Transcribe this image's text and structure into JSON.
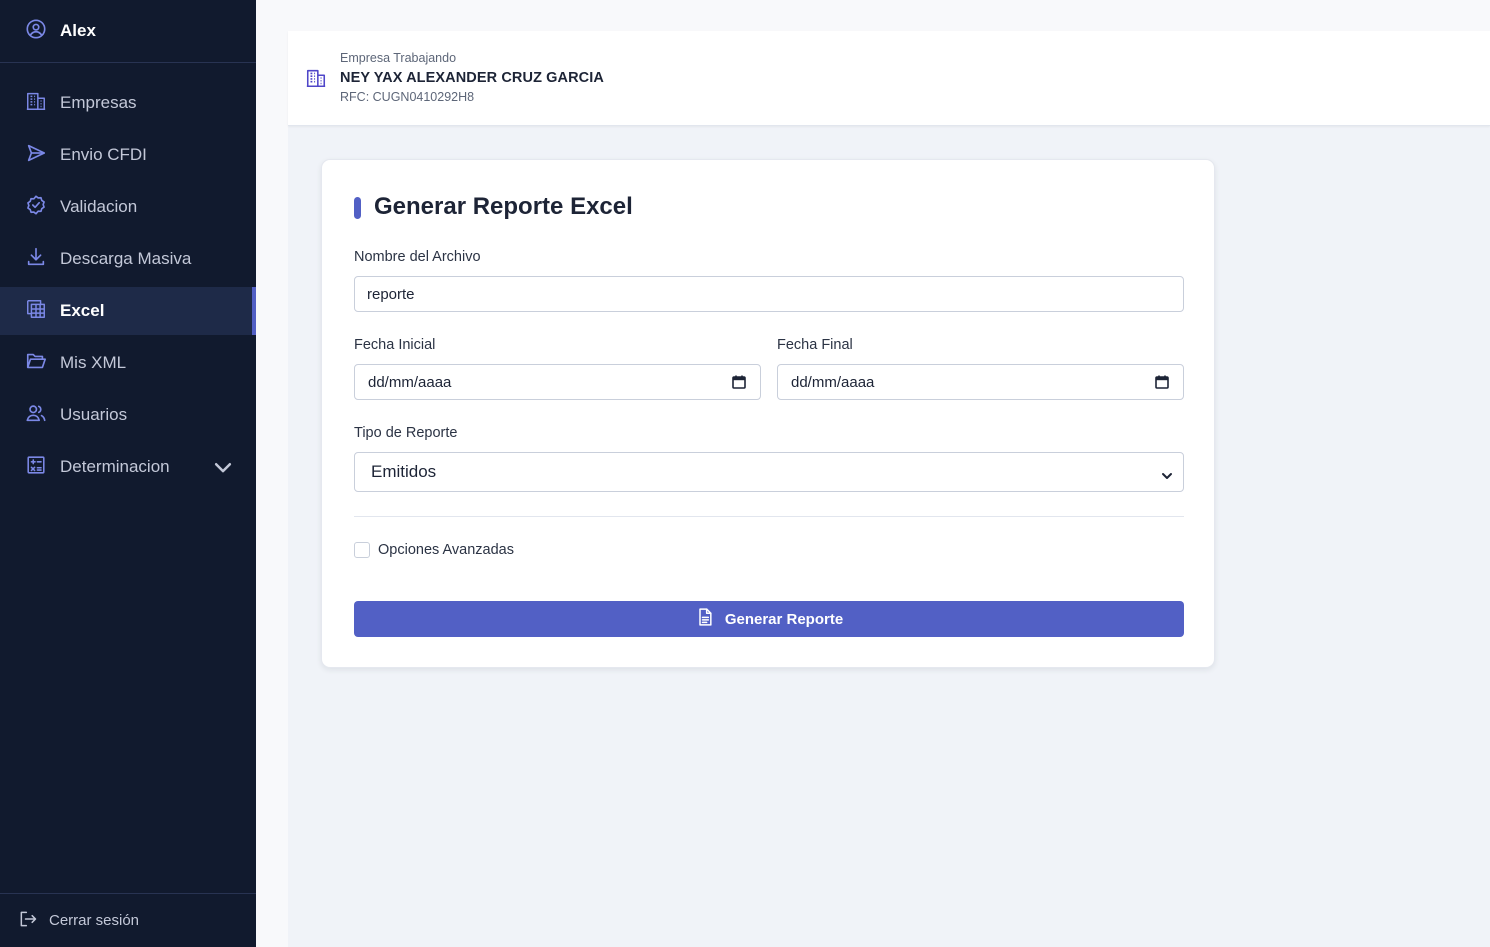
{
  "sidebar": {
    "user": {
      "name": "Alex",
      "icon": "user-circle-icon"
    },
    "items": [
      {
        "label": "Empresas",
        "icon": "building-icon"
      },
      {
        "label": "Envio CFDI",
        "icon": "send-icon"
      },
      {
        "label": "Validacion",
        "icon": "badge-check-icon"
      },
      {
        "label": "Descarga Masiva",
        "icon": "download-icon"
      },
      {
        "label": "Excel",
        "icon": "table-icon",
        "active": true
      },
      {
        "label": "Mis XML",
        "icon": "folder-open-icon"
      },
      {
        "label": "Usuarios",
        "icon": "users-icon"
      },
      {
        "label": "Determinacion",
        "icon": "calculator-icon",
        "expandable": true
      }
    ],
    "logout_label": "Cerrar sesión"
  },
  "company": {
    "caption": "Empresa Trabajando",
    "name": "NEY YAX ALEXANDER CRUZ GARCIA",
    "rfc": "RFC: CUGN0410292H8"
  },
  "form": {
    "title": "Generar Reporte Excel",
    "filename_label": "Nombre del Archivo",
    "filename_value": "reporte",
    "start_label": "Fecha Inicial",
    "start_placeholder": "dd/mm/aaaa",
    "end_label": "Fecha Final",
    "end_placeholder": "dd/mm/aaaa",
    "type_label": "Tipo de Reporte",
    "type_value": "Emitidos",
    "advanced_label": "Opciones Avanzadas",
    "submit_label": "Generar Reporte"
  },
  "colors": {
    "sidebar_bg": "#111a2e",
    "accent": "#5260c5",
    "active_bg": "#1e2a48",
    "icon_color": "#7b88e6"
  }
}
